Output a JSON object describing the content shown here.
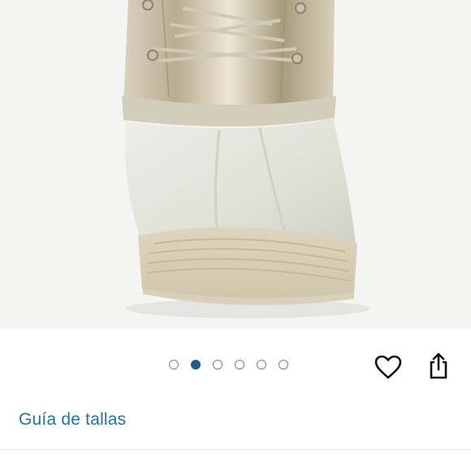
{
  "product": {
    "image_subject": "boot-image",
    "carousel": {
      "total": 6,
      "active_index": 1
    }
  },
  "actions": {
    "favorite_icon": "heart-icon",
    "share_icon": "share-icon"
  },
  "links": {
    "size_guide": "Guía de tallas"
  },
  "colors": {
    "link": "#2570a4",
    "active_dot": "#1d5d8c"
  }
}
